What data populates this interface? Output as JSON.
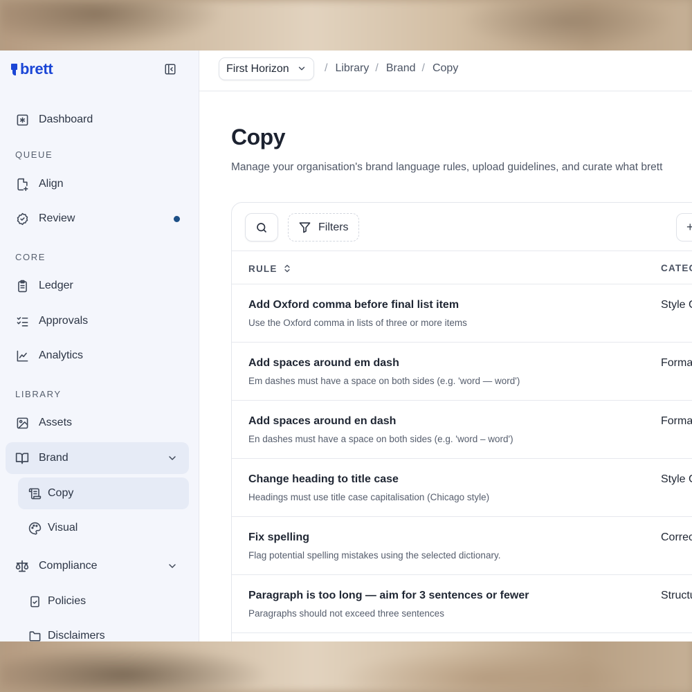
{
  "brand": {
    "name": "brett"
  },
  "sidebar": {
    "dashboard": "Dashboard",
    "sections": {
      "queue": "QUEUE",
      "core": "CORE",
      "library": "LIBRARY"
    },
    "queue_items": [
      {
        "label": "Align",
        "icon": "file-plus-icon"
      },
      {
        "label": "Review",
        "icon": "badge-check-icon",
        "has_indicator": true
      }
    ],
    "core_items": [
      {
        "label": "Ledger",
        "icon": "clipboard-icon"
      },
      {
        "label": "Approvals",
        "icon": "list-checks-icon"
      },
      {
        "label": "Analytics",
        "icon": "line-chart-icon"
      }
    ],
    "library_items": {
      "assets": "Assets",
      "brand": "Brand",
      "copy": "Copy",
      "visual": "Visual",
      "compliance": "Compliance",
      "policies": "Policies",
      "disclaimers": "Disclaimers"
    },
    "accent_color": "#1b46d6",
    "indicator_color": "#1c4f86"
  },
  "topbar": {
    "org": "First Horizon",
    "breadcrumbs": [
      "Library",
      "Brand",
      "Copy"
    ]
  },
  "page": {
    "title": "Copy",
    "description": "Manage your organisation's brand language rules, upload guidelines, and curate what brett"
  },
  "toolbar": {
    "filters_label": "Filters",
    "right_button_label": "+"
  },
  "table": {
    "columns": [
      "RULE",
      "CATEGORY"
    ],
    "rows": [
      {
        "title": "Add Oxford comma before final list item",
        "description": "Use the Oxford comma in lists of three or more items",
        "category": "Style Guide"
      },
      {
        "title": "Add spaces around em dash",
        "description": "Em dashes must have a space on both sides (e.g. 'word — word')",
        "category": "Formatting"
      },
      {
        "title": "Add spaces around en dash",
        "description": "En dashes must have a space on both sides (e.g. 'word – word')",
        "category": "Formatting"
      },
      {
        "title": "Change heading to title case",
        "description": "Headings must use title case capitalisation (Chicago style)",
        "category": "Style Guide"
      },
      {
        "title": "Fix spelling",
        "description": "Flag potential spelling mistakes using the selected dictionary.",
        "category": "Correctness"
      },
      {
        "title": "Paragraph is too long — aim for 3 sentences or fewer",
        "description": "Paragraphs should not exceed three sentences",
        "category": "Structure"
      }
    ]
  }
}
